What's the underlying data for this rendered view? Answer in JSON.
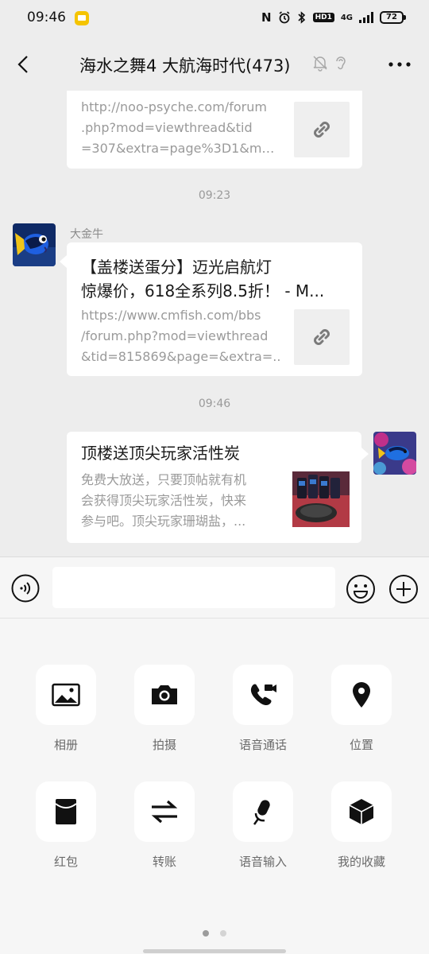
{
  "status_bar": {
    "time": "09:46",
    "nfc": "N",
    "hd_label": "HD1",
    "network": "4G",
    "battery": "72"
  },
  "header": {
    "title": "海水之舞4 大航海时代(473)",
    "back_icon": "chevron-left-icon",
    "more_icon": "more-horizontal-icon"
  },
  "messages": [
    {
      "type": "link_card",
      "url_lines": [
        "http://noo-psyche.com/forum",
        ".php?mod=viewthread&tid",
        "=307&extra=page%3D1&mo..."
      ]
    },
    {
      "type": "timestamp",
      "text": "09:23"
    },
    {
      "type": "link_card",
      "sender": "大金牛",
      "title_lines": [
        "【盖楼送蛋分】迈光启航灯",
        "惊爆价，618全系列8.5折！ - M..."
      ],
      "url_lines": [
        "https://www.cmfish.com/bbs",
        "/forum.php?mod=viewthread",
        "&tid=815869&page=&extra=..."
      ]
    },
    {
      "type": "timestamp",
      "text": "09:46"
    },
    {
      "type": "article_card",
      "title": "顶楼送顶尖玩家活性炭",
      "desc_lines": [
        "免费大放送，只要顶帖就有机",
        "会获得顶尖玩家活性炭，快来",
        "参与吧。顶尖玩家珊瑚盐，..."
      ]
    }
  ],
  "input": {
    "value": "",
    "placeholder": ""
  },
  "tools": [
    {
      "label": "相册",
      "icon": "image-icon"
    },
    {
      "label": "拍摄",
      "icon": "camera-icon"
    },
    {
      "label": "语音通话",
      "icon": "phone-video-icon"
    },
    {
      "label": "位置",
      "icon": "location-pin-icon"
    },
    {
      "label": "红包",
      "icon": "red-envelope-icon"
    },
    {
      "label": "转账",
      "icon": "transfer-icon"
    },
    {
      "label": "语音输入",
      "icon": "microphone-icon"
    },
    {
      "label": "我的收藏",
      "icon": "cube-icon"
    }
  ],
  "pager": {
    "pages": 2,
    "active": 1
  }
}
